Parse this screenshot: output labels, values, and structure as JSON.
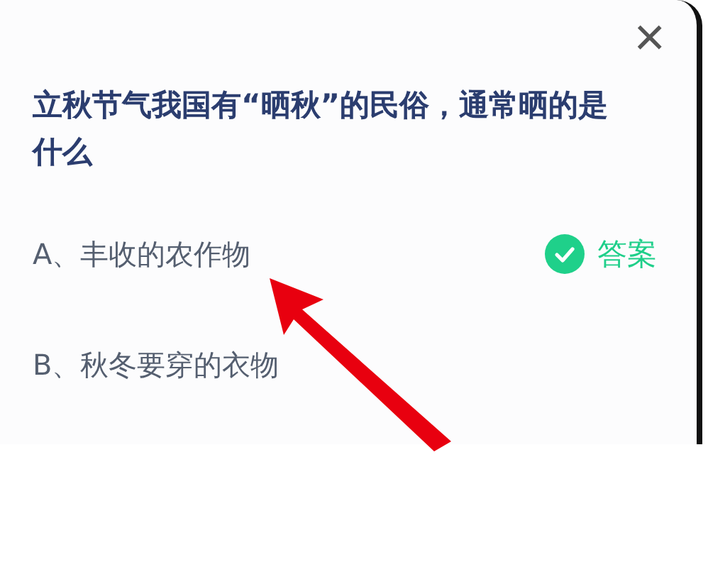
{
  "close_button": {
    "label": "×"
  },
  "question": "立秋节气我国有“晒秋”的民俗，通常晒的是什么",
  "options": [
    {
      "label": "A、丰收的农作物",
      "correct": true,
      "badge": "答案"
    },
    {
      "label": "B、秋冬要穿的衣物",
      "correct": false
    }
  ]
}
